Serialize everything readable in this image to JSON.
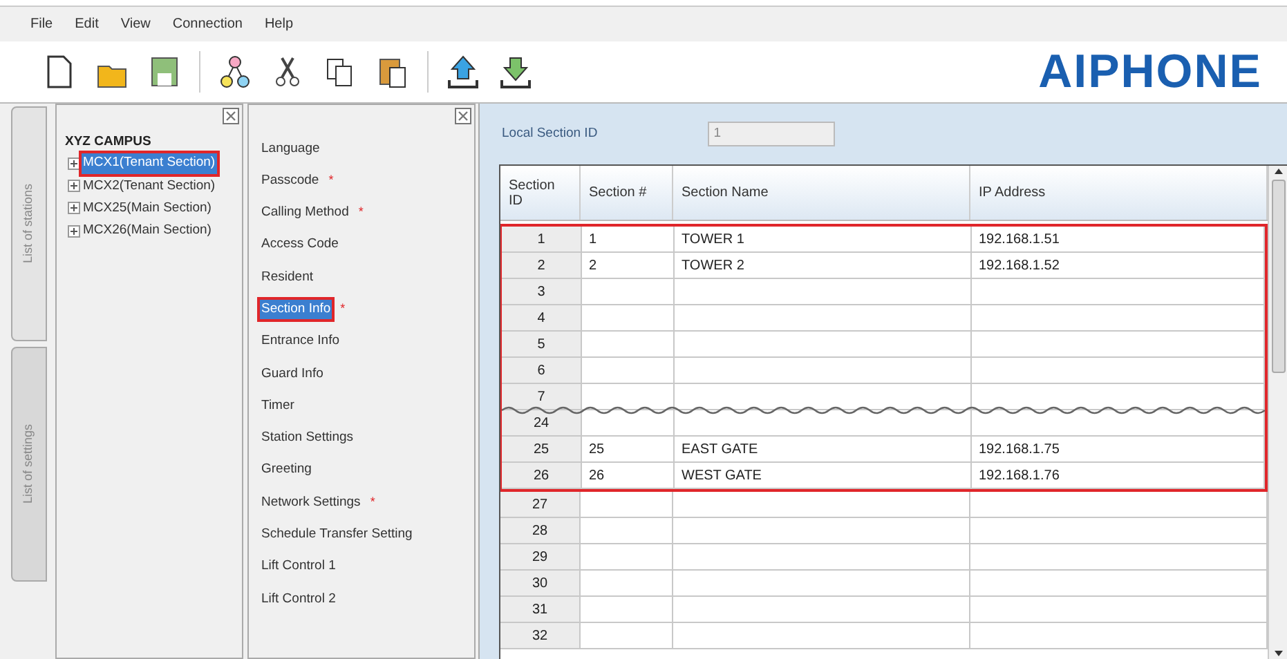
{
  "menu": [
    "File",
    "Edit",
    "View",
    "Connection",
    "Help"
  ],
  "logo": "AIPHONE",
  "side_tabs": [
    {
      "label": "List of stations",
      "selected": true
    },
    {
      "label": "List of settings",
      "selected": false
    }
  ],
  "tree": {
    "root": "XYZ CAMPUS",
    "items": [
      {
        "label": "MCX1(Tenant Section)",
        "selected": true,
        "expanded": false
      },
      {
        "label": "MCX2(Tenant Section)",
        "selected": false,
        "expanded": false
      },
      {
        "label": "MCX25(Main Section)",
        "selected": false,
        "expanded": false
      },
      {
        "label": "MCX26(Main Section)",
        "selected": false,
        "expanded": false
      }
    ]
  },
  "settings": [
    {
      "label": "Language",
      "selected": false
    },
    {
      "label": "Passcode",
      "marker": "*",
      "selected": false
    },
    {
      "label": "Calling Method",
      "marker": "*",
      "selected": false
    },
    {
      "label": "Access Code",
      "selected": false
    },
    {
      "label": "Resident",
      "selected": false
    },
    {
      "label": "Section Info",
      "marker": "*",
      "selected": true
    },
    {
      "label": "Entrance Info",
      "selected": false
    },
    {
      "label": "Guard Info",
      "selected": false
    },
    {
      "label": "Timer",
      "selected": false
    },
    {
      "label": "Station Settings",
      "selected": false
    },
    {
      "label": "Greeting",
      "selected": false
    },
    {
      "label": "Network Settings",
      "marker": "*",
      "selected": false
    },
    {
      "label": "Schedule Transfer Setting",
      "selected": false
    },
    {
      "label": "Lift Control 1",
      "selected": false
    },
    {
      "label": "Lift Control 2",
      "selected": false
    }
  ],
  "local_section_id": {
    "label": "Local Section ID",
    "value": "1"
  },
  "table": {
    "columns": [
      "Section ID",
      "Section #",
      "Section Name",
      "IP Address"
    ],
    "highlighted_rows": [
      {
        "kind": "row",
        "cells": [
          "1",
          "1",
          "TOWER 1",
          "192.168.1.51"
        ]
      },
      {
        "kind": "row",
        "cells": [
          "2",
          "2",
          "TOWER 2",
          "192.168.1.52"
        ]
      },
      {
        "kind": "row",
        "cells": [
          "3",
          "",
          "",
          ""
        ]
      },
      {
        "kind": "row",
        "cells": [
          "4",
          "",
          "",
          ""
        ]
      },
      {
        "kind": "row",
        "cells": [
          "5",
          "",
          "",
          ""
        ]
      },
      {
        "kind": "row",
        "cells": [
          "6",
          "",
          "",
          ""
        ]
      },
      {
        "kind": "row",
        "cells": [
          "7",
          "",
          "",
          ""
        ]
      },
      {
        "kind": "break"
      },
      {
        "kind": "row",
        "cells": [
          "24",
          "",
          "",
          ""
        ]
      },
      {
        "kind": "row",
        "cells": [
          "25",
          "25",
          "EAST GATE",
          "192.168.1.75"
        ]
      },
      {
        "kind": "row",
        "cells": [
          "26",
          "26",
          "WEST GATE",
          "192.168.1.76"
        ]
      }
    ],
    "rows": [
      {
        "kind": "row",
        "cells": [
          "27",
          "",
          "",
          ""
        ]
      },
      {
        "kind": "row",
        "cells": [
          "28",
          "",
          "",
          ""
        ]
      },
      {
        "kind": "row",
        "cells": [
          "29",
          "",
          "",
          ""
        ]
      },
      {
        "kind": "row",
        "cells": [
          "30",
          "",
          "",
          ""
        ]
      },
      {
        "kind": "row",
        "cells": [
          "31",
          "",
          "",
          ""
        ]
      },
      {
        "kind": "row",
        "cells": [
          "32",
          "",
          "",
          ""
        ]
      }
    ]
  }
}
